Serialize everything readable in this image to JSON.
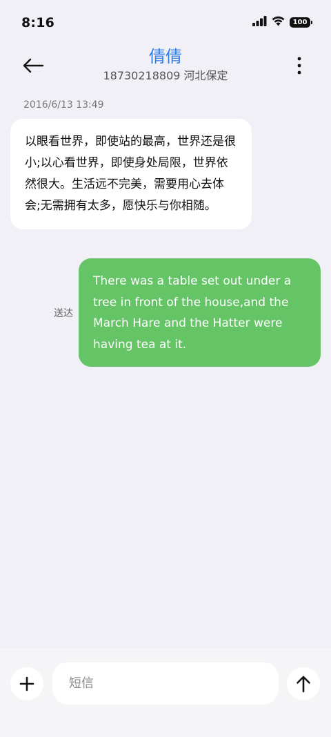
{
  "status_bar": {
    "time": "8:16",
    "battery": "100",
    "icons": [
      "signal-icon",
      "wifi-icon",
      "battery-icon"
    ]
  },
  "header": {
    "title": "倩倩",
    "subtitle": "18730218809 河北保定",
    "title_color": "#2f7fe6"
  },
  "thread": {
    "timestamp": "2016/6/13 13:49",
    "incoming_message": "以眼看世界，即使站的最高，世界还是很小;以心看世界，即使身处局限，世界依然很大。生活远不完美，需要用心去体会;无需拥有太多，愿快乐与你相随。",
    "outgoing_message": "There was a table set out under a tree in front of the house,and the March Hare and the Hatter were having tea at it.",
    "outgoing_status": "送达",
    "outgoing_bubble_color": "#65c466"
  },
  "composer": {
    "placeholder": "短信",
    "value": ""
  }
}
